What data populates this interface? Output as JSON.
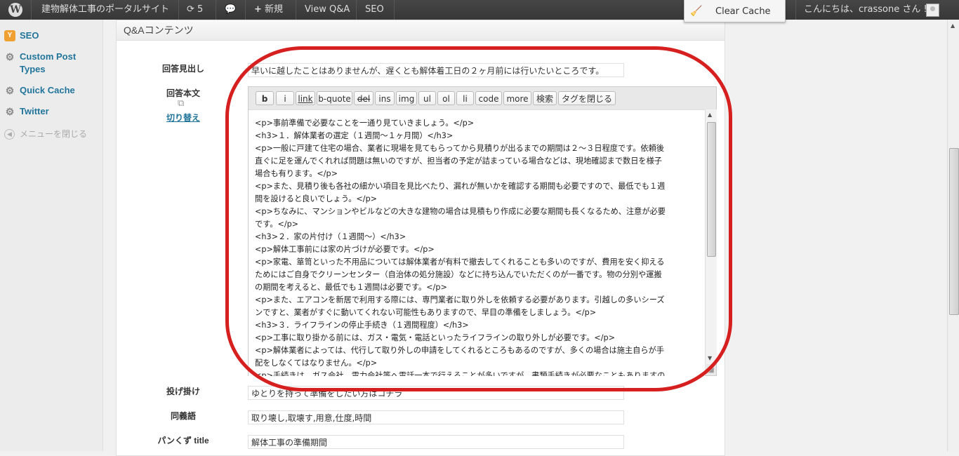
{
  "adminbar": {
    "site_name": "建物解体工事のポータルサイト",
    "updates_count": "5",
    "new_label": "新規",
    "view_qa": "View Q&A",
    "seo": "SEO",
    "clear_cache": "Clear Cache",
    "greeting": "こんにちは、crassone さん !",
    "icons": [
      "wordpress-logo-icon",
      "refresh-icon",
      "comment-icon",
      "plus-icon",
      "broom-icon",
      "avatar"
    ]
  },
  "sidebar": {
    "items": [
      {
        "label": "SEO",
        "icon": "seo-icon"
      },
      {
        "label": "Custom Post Types",
        "icon": "gear-icon"
      },
      {
        "label": "Quick Cache",
        "icon": "gear-icon"
      },
      {
        "label": "Twitter",
        "icon": "gear-icon"
      },
      {
        "label": "メニューを閉じる",
        "icon": "collapse-arrow-icon"
      }
    ]
  },
  "panel": {
    "title": "Q&Aコンテンツ",
    "fields": {
      "answer_heading": {
        "label": "回答見出し",
        "value": "早いに越したことはありませんが、遅くとも解体着工日の２ヶ月前には行いたいところです。"
      },
      "answer_body": {
        "label": "回答本文",
        "toggle": "切り替え"
      },
      "throw": {
        "label": "投げ掛け",
        "value": "ゆとりを持って準備をしたい方はコチラ"
      },
      "synonyms": {
        "label": "同義語",
        "value": "取り壊し,取壊す,用意,仕度,時間"
      },
      "breadcrumb_title": {
        "label": "パンくず title",
        "value": "解体工事の準備期間"
      }
    },
    "quicktags": [
      "b",
      "i",
      "link",
      "b-quote",
      "del",
      "ins",
      "img",
      "ul",
      "ol",
      "li",
      "code",
      "more",
      "検索",
      "タグを閉じる"
    ],
    "body_lines": [
      "<p>事前準備で必要なことを一通り見ていきましょう。</p>",
      "<h3>１．解体業者の選定（１週間～１ヶ月間）</h3>",
      "<p>一般に戸建て住宅の場合、業者に現場を見てもらってから見積りが出るまでの期間は２～３日程度です。依頼後",
      "直ぐに足を運んでくれれば問題は無いのですが、担当者の予定が詰まっている場合などは、現地確認まで数日を様子",
      "場合も有ります。</p>",
      "<p>また、見積り後も各社の細かい項目を見比べたり、漏れが無いかを確認する期間も必要ですので、最低でも１週",
      "間を設けると良いでしょう。</p>",
      "<p>ちなみに、マンションやビルなどの大きな建物の場合は見積もり作成に必要な期間も長くなるため、注意が必要",
      "です。</p>",
      "<h3>２．家の片付け（１週間～）</h3>",
      "<p>解体工事前には家の片づけが必要です。</p>",
      "<p>家電、箪笥といった不用品については解体業者が有料で撤去してくれることも多いのですが、費用を安く抑える",
      "ためにはご自身でクリーンセンター（自治体の処分施設）などに持ち込んでいただくのが一番です。物の分別や運搬",
      "の期間を考えると、最低でも１週間は必要です。</p>",
      "<p>また、エアコンを新居で利用する際には、専門業者に取り外しを依頼する必要があります。引越しの多いシーズ",
      "ンですと、業者がすぐに動いてくれない可能性もありますので、早目の準備をしましょう。</p>",
      "<h3>３．ライフラインの停止手続き（１週間程度）</h3>",
      "<p>工事に取り掛かる前には、ガス・電気・電話といったライフラインの取り外しが必要です。</p>",
      "<p>解体業者によっては、代行して取り外しの申請をしてくれるところもあるのですが、多くの場合は施主自らが手",
      "配をしなくてはなりません。</p>",
      "<p>手続きは、ガス会社、電力会社等へ電話一本で行えることが多いですが、書類手続きが必要なこともありますの"
    ]
  }
}
